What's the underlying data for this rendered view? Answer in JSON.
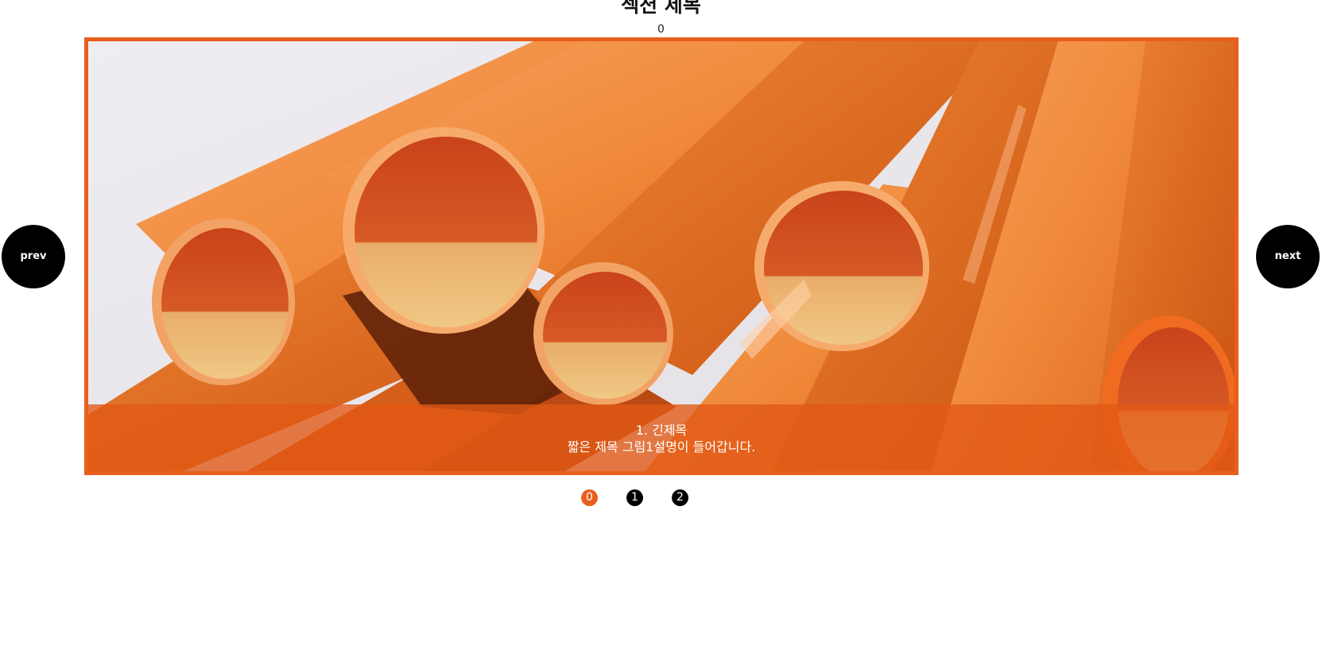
{
  "section": {
    "title": "섹션 제목",
    "counter": "0"
  },
  "slider": {
    "active_index": 0,
    "caption": {
      "title": "1. 긴제목",
      "description": "짧은 제목 그림1설명이 들어갑니다."
    },
    "prev_label": "prev",
    "next_label": "next",
    "dots": [
      {
        "label": "0",
        "active": true
      },
      {
        "label": "1",
        "active": false
      },
      {
        "label": "2",
        "active": false
      }
    ]
  },
  "colors": {
    "accent": "#e95f1d",
    "button": "#000000",
    "caption_bg": "#e25814"
  }
}
